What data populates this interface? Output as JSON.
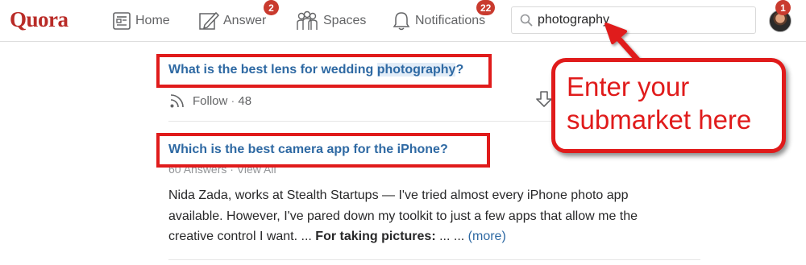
{
  "brand": {
    "logo_text": "Quora",
    "accent_color": "#b92b27"
  },
  "nav": {
    "home_label": "Home",
    "answer_label": "Answer",
    "answer_badge": "2",
    "spaces_label": "Spaces",
    "notifications_label": "Notifications",
    "notifications_badge": "22",
    "avatar_badge": "1"
  },
  "search": {
    "value": "photography",
    "icon": "search-icon"
  },
  "feed": {
    "questions": [
      {
        "title_before": "What is the best lens for wedding ",
        "title_highlight": "photography",
        "title_after": "?",
        "follow_label": "Follow",
        "follow_separator": "·",
        "follow_count": "48"
      },
      {
        "title": "Which is the best camera app for the iPhone?",
        "answers_meta": "60 Answers · View All",
        "answer_lines": [
          "Nida Zada, works at Stealth Startups — I've tried almost every iPhone photo app",
          "available. However, I've pared down my toolkit to just a few apps that allow me the",
          "creative control I want. ... "
        ],
        "answer_bold": "For taking pictures:",
        "answer_tail": " ... ... ",
        "more_label": "(more)"
      }
    ]
  },
  "annotation": {
    "callout_line1": "Enter your",
    "callout_line2": "submarket here",
    "color": "#e01b1b"
  }
}
